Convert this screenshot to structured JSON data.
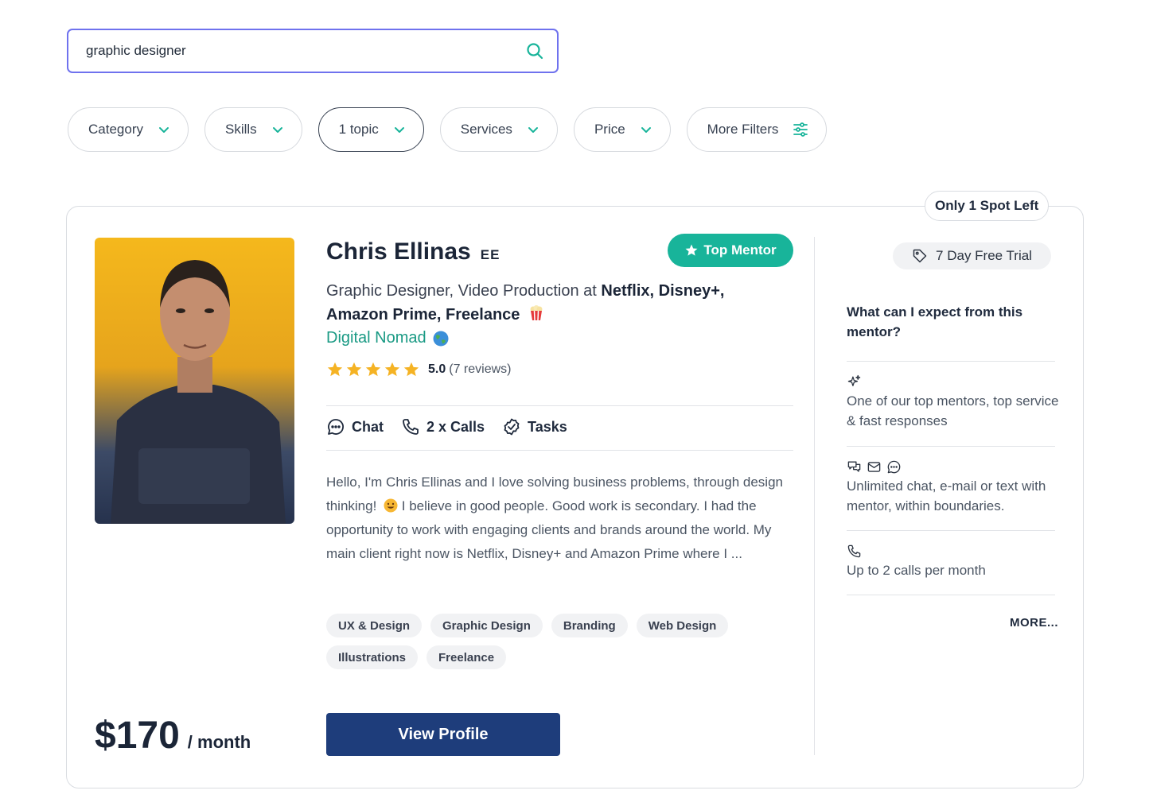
{
  "search": {
    "value": "graphic designer",
    "icon": "search-icon"
  },
  "filters": [
    {
      "label": "Category",
      "icon": "chevron-down-icon",
      "active": false
    },
    {
      "label": "Skills",
      "icon": "chevron-down-icon",
      "active": false
    },
    {
      "label": "1 topic",
      "icon": "chevron-down-icon",
      "active": true
    },
    {
      "label": "Services",
      "icon": "chevron-down-icon",
      "active": false
    },
    {
      "label": "Price",
      "icon": "chevron-down-icon",
      "active": false
    },
    {
      "label": "More Filters",
      "icon": "sliders-icon",
      "active": false
    }
  ],
  "mentor": {
    "spot_badge": "Only 1 Spot Left",
    "name": "Chris Ellinas",
    "initials": "EE",
    "top_badge": "Top Mentor",
    "headline_plain": "Graphic Designer, Video Production at ",
    "headline_bold_1": "Netflix, Disney+,",
    "headline_bold_2": "Amazon Prime, Freelance",
    "location": "Digital Nomad",
    "rating": {
      "score": "5.0",
      "reviews": "(7 reviews)",
      "stars": 5
    },
    "features": [
      {
        "label": "Chat",
        "icon": "chat-icon"
      },
      {
        "label": "2 x Calls",
        "icon": "phone-icon"
      },
      {
        "label": "Tasks",
        "icon": "check-badge-icon"
      }
    ],
    "bio_1": "Hello, I'm Chris Ellinas and I love solving business problems, through design thinking!",
    "bio_2": " I believe in good people. Good work is secondary. I had the opportunity to work with engaging clients and brands around the world. My main client right now is Netflix, Disney+ and Amazon Prime where I ...",
    "tags": [
      "UX & Design",
      "Graphic Design",
      "Branding",
      "Web Design",
      "Illustrations",
      "Freelance"
    ],
    "price": {
      "amount": "$170",
      "period": "/ month"
    },
    "view_profile": "View Profile"
  },
  "sidebar": {
    "trial": "7 Day Free Trial",
    "expect_title": "What can I expect from this mentor?",
    "benefits": [
      {
        "text": "One of our top mentors, top service & fast responses",
        "icons": [
          "sparkle-icon"
        ]
      },
      {
        "text": "Unlimited chat, e-mail or text with mentor, within boundaries.",
        "icons": [
          "chat-bubbles-icon",
          "mail-icon",
          "message-icon"
        ]
      },
      {
        "text": "Up to 2 calls per month",
        "icons": [
          "phone-icon"
        ]
      }
    ],
    "more": "MORE..."
  },
  "colors": {
    "accent": "#18b49a",
    "primary": "#1e3d7b",
    "search_border": "#6f72ee",
    "star": "#f5b324"
  }
}
